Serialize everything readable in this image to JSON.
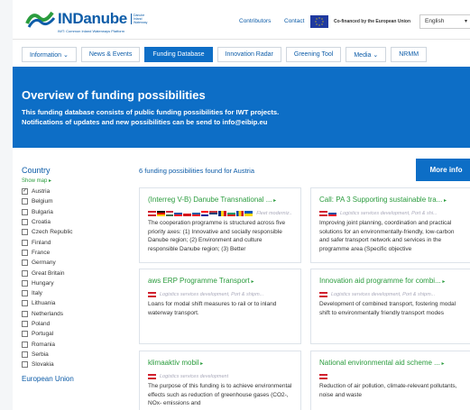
{
  "header": {
    "logo_text": "INDanube",
    "logo_sub": "IWT: Common Inland Waterways Platform",
    "logo_box": "Danube Inland Waterway",
    "links": [
      "Contributors",
      "Contact"
    ],
    "cofund": "Co-financed by the European Union",
    "language": "English"
  },
  "nav": {
    "items": [
      "Information",
      "News & Events",
      "Funding Database",
      "Innovation Radar",
      "Greening Tool",
      "Media",
      "NRMM"
    ]
  },
  "hero": {
    "title": "Overview of funding possibilities",
    "line1": "This funding database consists of public funding possibilities for IWT projects.",
    "line2": "Notifications of updates and new possibilities can be send to info@eibip.eu"
  },
  "sidebar": {
    "title": "Country",
    "show_map": "Show map",
    "countries": [
      {
        "name": "Austria",
        "checked": true
      },
      {
        "name": "Belgium",
        "checked": false
      },
      {
        "name": "Bulgaria",
        "checked": false
      },
      {
        "name": "Croatia",
        "checked": false
      },
      {
        "name": "Czech Republic",
        "checked": false
      },
      {
        "name": "Finland",
        "checked": false
      },
      {
        "name": "France",
        "checked": false
      },
      {
        "name": "Germany",
        "checked": false
      },
      {
        "name": "Great Britain",
        "checked": false
      },
      {
        "name": "Hungary",
        "checked": false
      },
      {
        "name": "Italy",
        "checked": false
      },
      {
        "name": "Lithuania",
        "checked": false
      },
      {
        "name": "Netherlands",
        "checked": false
      },
      {
        "name": "Poland",
        "checked": false
      },
      {
        "name": "Portugal",
        "checked": false
      },
      {
        "name": "Romania",
        "checked": false
      },
      {
        "name": "Serbia",
        "checked": false
      },
      {
        "name": "Slovakia",
        "checked": false
      }
    ],
    "eu_title": "European Union"
  },
  "main": {
    "found": "6 funding possibilities found for Austria",
    "more_info": "More info",
    "cards": [
      {
        "title": "(Interreg V-B) Danube Transnational ...",
        "flags": [
          "at",
          "de",
          "hu",
          "sk",
          "cz",
          "si",
          "hr",
          "rs",
          "ro",
          "bg",
          "md",
          "ua"
        ],
        "tag": "Fleet moderniz...",
        "desc": "The cooperation programme is structured across five priority axes: (1) Innovative and socially responsible Danube region; (2) Environment and culture responsible Danube region; (3) Better"
      },
      {
        "title": "Call: PA 3 Supporting sustainable tra...",
        "flags": [
          "at",
          "sk"
        ],
        "tag": "Logistics services development, Port & shi...",
        "desc": "Improving joint planning, coordination and practical solutions for an environmentally-friendly, low-carbon and safer transport network and services in the programme area (Specific objective"
      },
      {
        "title": "aws ERP Programme Transport",
        "flags": [
          "at"
        ],
        "tag": "Logistics services development, Port & shipm...",
        "desc": "Loans for modal shift measures to rail or to inland waterway transport."
      },
      {
        "title": "Innovation aid programme for combi...",
        "flags": [
          "at"
        ],
        "tag": "Logistics services development, Port & shipm...",
        "desc": "Development of combined transport, fostering modal shift to environmentally friendly transport modes"
      },
      {
        "title": "klimaaktiv mobil",
        "flags": [
          "at"
        ],
        "tag": "Logistics services development",
        "desc": "The purpose of this funding is to achieve environmental effects such as reduction of greenhouse gases (CO2-, NOx- emissions and"
      },
      {
        "title": "National environmental aid scheme ...",
        "flags": [
          "at"
        ],
        "tag": "",
        "desc": "Reduction of air pollution, climate-relevant pollutants, noise and waste"
      }
    ]
  }
}
